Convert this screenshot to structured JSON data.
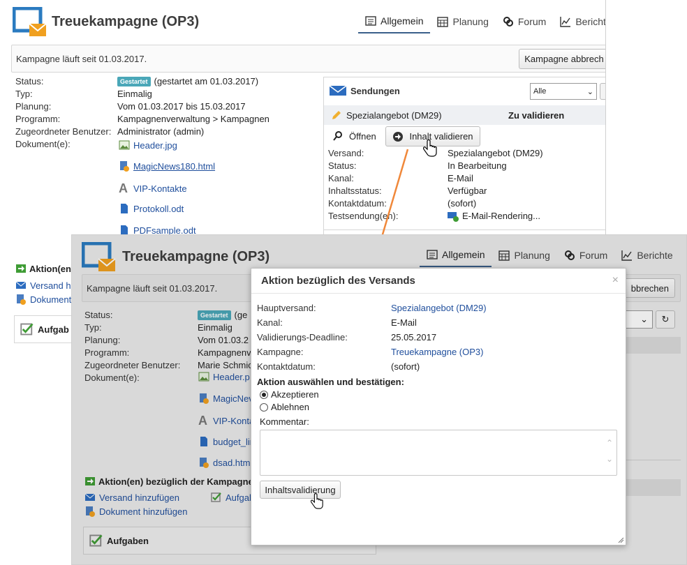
{
  "back": {
    "title": "Treuekampagne (OP3)",
    "tabs": [
      {
        "label": "Allgemein",
        "icon": "list-icon",
        "active": true
      },
      {
        "label": "Planung",
        "icon": "calendar-icon"
      },
      {
        "label": "Forum",
        "icon": "forum-icon"
      },
      {
        "label": "Bericht",
        "icon": "chart-icon"
      }
    ],
    "status_bar": "Kampagne läuft seit 01.03.2017.",
    "abort_button": "Kampagne abbrech",
    "props": {
      "status_label": "Status:",
      "status_badge": "Gestartet",
      "status_value": "(gestartet am 01.03.2017)",
      "typ_label": "Typ:",
      "typ_value": "Einmalig",
      "planung_label": "Planung:",
      "planung_value": "Vom 01.03.2017 bis 15.03.2017",
      "programm_label": "Programm:",
      "programm_value": "Kampagnenverwaltung > Kampagnen",
      "benutzer_label": "Zugeordneter Benutzer:",
      "benutzer_value": "Administrator (admin)",
      "dokumente_label": "Dokument(e):"
    },
    "documents": [
      "Header.jpg",
      "MagicNews180.html",
      "VIP-Kontakte",
      "Protokoll.odt",
      "PDFsample.odt"
    ],
    "actions_title": "Aktion(en",
    "action_links": [
      "Versand h",
      "Dokument"
    ],
    "tasks_title": "Aufgab",
    "sendungen": {
      "title": "Sendungen",
      "filter": "Alle",
      "item_name": "Spezialangebot (DM29)",
      "item_status": "Zu validieren",
      "open_label": "Öffnen",
      "validate_label": "Inhalt validieren",
      "details": [
        {
          "k": "Versand:",
          "v": "Spezialangebot (DM29)"
        },
        {
          "k": "Status:",
          "v": "In Bearbeitung"
        },
        {
          "k": "Kanal:",
          "v": "E-Mail"
        },
        {
          "k": "Inhaltsstatus:",
          "v": "Verfügbar"
        },
        {
          "k": "Kontaktdatum:",
          "v": "(sofort)"
        },
        {
          "k": "Testsendung(en):",
          "v": "E-Mail-Rendering..."
        }
      ]
    }
  },
  "front": {
    "title": "Treuekampagne (OP3)",
    "tabs": [
      {
        "label": "Allgemein",
        "icon": "list-icon",
        "active": true
      },
      {
        "label": "Planung",
        "icon": "calendar-icon"
      },
      {
        "label": "Forum",
        "icon": "forum-icon"
      },
      {
        "label": "Berichte",
        "icon": "chart-icon"
      }
    ],
    "status_bar": "Kampagne läuft seit 01.03.2017.",
    "abort_button_partial": "bbrechen",
    "props": {
      "status_label": "Status:",
      "status_badge": "Gestartet",
      "status_value": "(ge",
      "typ_label": "Typ:",
      "typ_value": "Einmalig",
      "planung_label": "Planung:",
      "planung_value": "Vom 01.03.2",
      "programm_label": "Programm:",
      "programm_value": "Kampagnenv",
      "benutzer_label": "Zugeordneter Benutzer:",
      "benutzer_value": "Marie Schmic",
      "dokumente_label": "Dokument(e):"
    },
    "documents": [
      "Header.p",
      "MagicNev",
      "VIP-Konta",
      "budget_lir",
      "dsad.html"
    ],
    "actions_title": "Aktion(en) bezüglich der Kampagne",
    "action_links": [
      "Versand hinzufügen",
      "Dokument hinzufügen"
    ],
    "task_link": "Aufgab",
    "tasks_title": "Aufgaben"
  },
  "modal": {
    "title": "Aktion bezüglich des Versands",
    "close": "×",
    "rows": [
      {
        "k": "Hauptversand:",
        "v": "Spezialangebot (DM29)",
        "link": true
      },
      {
        "k": "Kanal:",
        "v": "E-Mail",
        "link": false
      },
      {
        "k": "Validierungs-Deadline:",
        "v": "25.05.2017",
        "link": false
      },
      {
        "k": "Kampagne:",
        "v": "Treuekampagne (OP3)",
        "link": true
      },
      {
        "k": "Kontaktdatum:",
        "v": "(sofort)",
        "link": false
      }
    ],
    "choose_label": "Aktion auswählen und bestätigen:",
    "accept_label": "Akzeptieren",
    "reject_label": "Ablehnen",
    "comment_label": "Kommentar:",
    "comment_value": "",
    "submit_label": "Inhaltsvalidierung"
  },
  "colors": {
    "accent": "#3a5f8a",
    "link": "#1f4e9c",
    "badge": "#4aa7b8",
    "arrow": "#f0883a"
  }
}
